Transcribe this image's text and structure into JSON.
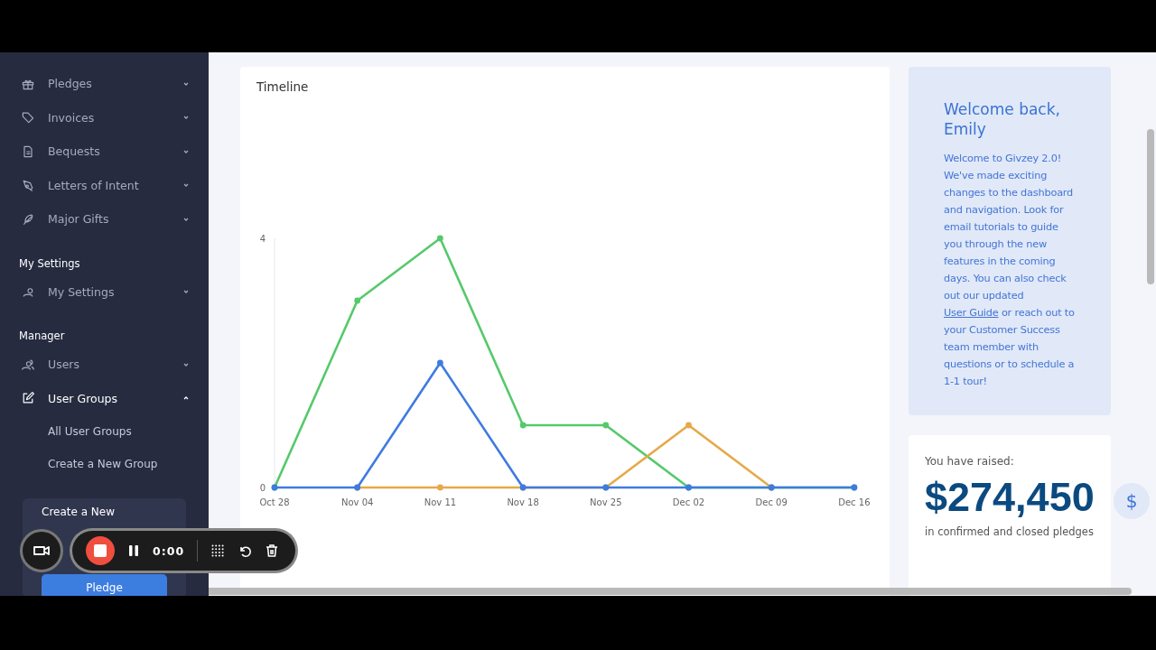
{
  "sidebar": {
    "items": [
      {
        "label": "Pledges",
        "expanded": false
      },
      {
        "label": "Invoices",
        "expanded": false
      },
      {
        "label": "Bequests",
        "expanded": false
      },
      {
        "label": "Letters of Intent",
        "expanded": false
      },
      {
        "label": "Major Gifts",
        "expanded": false
      }
    ],
    "sections": [
      {
        "title": "My Settings",
        "items": [
          {
            "label": "My Settings",
            "expanded": false
          }
        ]
      },
      {
        "title": "Manager",
        "items": [
          {
            "label": "Users",
            "expanded": false
          },
          {
            "label": "User Groups",
            "expanded": true,
            "children": [
              "All User Groups",
              "Create a New Group"
            ]
          }
        ]
      }
    ],
    "create_card": {
      "title": "Create a New",
      "button": "Pledge"
    }
  },
  "timeline": {
    "title": "Timeline",
    "chart_data": {
      "type": "line",
      "categories": [
        "Oct 28",
        "Nov 04",
        "Nov 11",
        "Nov 18",
        "Nov 25",
        "Dec 02",
        "Dec 09",
        "Dec 16"
      ],
      "yticks": [
        0,
        4
      ],
      "ylim": [
        0,
        4
      ],
      "series": [
        {
          "color": "#55c96b",
          "marker": "circle",
          "values": [
            0,
            3,
            4,
            1,
            1,
            0,
            0,
            0
          ]
        },
        {
          "color": "#e6a94a",
          "marker": "circle",
          "values": [
            null,
            0,
            0,
            0,
            0,
            1,
            0,
            null
          ]
        },
        {
          "color": "#3e7be0",
          "marker": "circle",
          "values": [
            0,
            0,
            2,
            0,
            0,
            0,
            0,
            0
          ]
        }
      ]
    }
  },
  "welcome": {
    "title": "Welcome back, Emily",
    "body_before": "Welcome to Givzey 2.0! We've made exciting changes to the dashboard and navigation. Look for email tutorials to guide you through the new features in the coming days. You can also check out our updated",
    "link": "User Guide",
    "body_after": "or reach out to your Customer Success team member with questions or to schedule a 1-1 tour!"
  },
  "raised": {
    "label": "You have raised:",
    "amount": "$274,450",
    "caption": "in confirmed and closed pledges",
    "badge": "$"
  },
  "recorder": {
    "time": "0:00"
  }
}
